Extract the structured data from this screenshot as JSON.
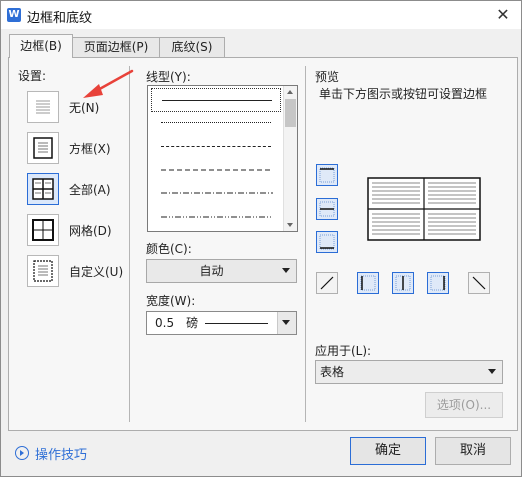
{
  "window": {
    "title": "边框和底纹",
    "app_icon": "W"
  },
  "tabs": [
    {
      "label": "边框(B)",
      "active": true
    },
    {
      "label": "页面边框(P)",
      "active": false
    },
    {
      "label": "底纹(S)",
      "active": false
    }
  ],
  "setting": {
    "title": "设置:",
    "options": [
      {
        "label": "无(N)",
        "icon": "border-none-icon",
        "selected": false
      },
      {
        "label": "方框(X)",
        "icon": "border-box-icon",
        "selected": false
      },
      {
        "label": "全部(A)",
        "icon": "border-all-icon",
        "selected": true
      },
      {
        "label": "网格(D)",
        "icon": "border-grid-icon",
        "selected": false
      },
      {
        "label": "自定义(U)",
        "icon": "border-custom-icon",
        "selected": false
      }
    ]
  },
  "style": {
    "title": "线型(Y):",
    "line_styles": [
      "solid",
      "dotted",
      "dashed-small",
      "dashed",
      "dash-dot",
      "dash-dot-dot"
    ],
    "selected": "solid"
  },
  "color": {
    "title": "颜色(C):",
    "value": "自动"
  },
  "width": {
    "title": "宽度(W):",
    "value": "0.5　磅"
  },
  "preview": {
    "title": "预览",
    "hint": "单击下方图示或按钮可设置边框"
  },
  "apply_to": {
    "title": "应用于(L):",
    "value": "表格"
  },
  "buttons": {
    "options": "选项(O)...",
    "ok": "确定",
    "cancel": "取消"
  },
  "tips": {
    "label": "操作技巧"
  },
  "annotation": {
    "color": "#e8423a"
  }
}
